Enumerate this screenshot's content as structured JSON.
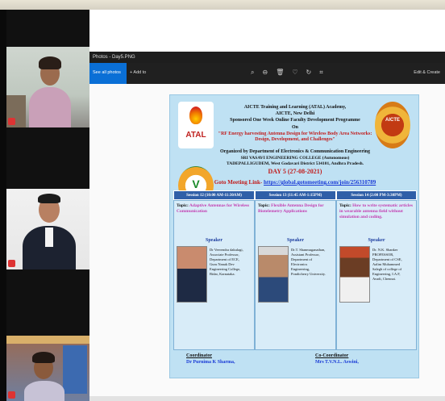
{
  "window": {
    "title": "Photos - Day5.PNG"
  },
  "toolbar": {
    "see_all_label": "See all photos",
    "add_to_label": "+  Add to",
    "edit_create_label": "Edit & Create",
    "icons": [
      "zoom-in-icon",
      "zoom-out-icon",
      "delete-icon",
      "favorite-icon",
      "rotate-icon",
      "crop-icon"
    ]
  },
  "poster": {
    "atal_logo_text": "ATAL",
    "aicte_logo_text": "AICTE",
    "line1": "AICTE Training and Learning (ATAL) Academy,",
    "line2": "AICTE, New Delhi",
    "line3": "Sponsored One Week Online Faculty Development Programme",
    "line4": "On",
    "line5": "\"RF Energy harvesting Antenna Design for Wireless Body Area Networks: Design, Development, and Challenges\"",
    "line6": "Organized by Department of Electronics & Communication Engineering",
    "line7": "SRI VASAVI ENGINEERING COLLEGE (Autonomous)",
    "line8": "TADEPALLIGUDEM, West Godavari District 534101, Andhra Pradesh.",
    "day": "DAY 5 (27-08-2021)",
    "goto_label": "Goto Meeting Link-",
    "goto_url": "https://global.gotomeeting.com/join/256310789",
    "sessions": [
      {
        "header": "Session 12 (10:00 AM-11:30AM)",
        "topic_label": "Topic:",
        "topic": "Adaptive Antennas for Wireless Communication",
        "speaker_label": "Speaker",
        "speaker_lines": [
          "Dr Veerendra dakulagi,",
          "Associate Professor,",
          "Department of ECE,",
          "Guru Nanak Dev",
          "Engineering College,",
          "Bidar, Karnataka."
        ]
      },
      {
        "header": "Session 13 (11:45 AM-1:15PM)",
        "topic_label": "Topic:",
        "topic": "Flexible Antenna Design for Biotelemetry Applications",
        "speaker_label": "Speaker",
        "speaker_lines": [
          "Dr.T. Shanmuganathan,",
          "Assistant Professor,",
          "Department of",
          "Electronics",
          "Engineering,",
          "Pondicherry University."
        ]
      },
      {
        "header": "Session 14 (2:00 PM-3:30PM)",
        "topic_label": "Topic:",
        "topic": "How to write systematic articles in wearable antenna field without simulation and coding.",
        "speaker_label": "Speaker",
        "speaker_lines": [
          "Dr. N.K. Shanker",
          "PROFESSOR,",
          "Department of CSE,",
          "Aalim Muhammed",
          "Salegh of college of",
          "Engineering, I.A.F,",
          "Avadi, Chennai."
        ]
      }
    ],
    "coordinator_role": "Coordinator",
    "coordinator_name": "Dr Purnima K Sharma,",
    "cocoordinator_role": "Co-Coordinator",
    "cocoordinator_name": "Mrs T.V.N.L. Aswini,"
  },
  "colors": {
    "poster_bg": "#bfe1f3",
    "session_header": "#2f5fa8",
    "accent_red": "#c11b1b",
    "link_blue": "#1a3bd6",
    "photos_accent": "#0a6fd6"
  }
}
